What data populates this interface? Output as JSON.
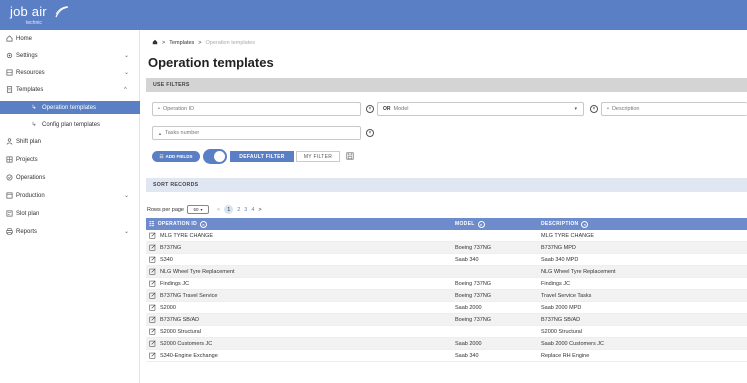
{
  "app": {
    "logo": "job air",
    "logo_sub": "technic"
  },
  "sidebar": {
    "items": [
      {
        "label": "Home",
        "icon": "home-icon"
      },
      {
        "label": "Settings",
        "icon": "gear-icon"
      },
      {
        "label": "Resources",
        "icon": "resources-icon"
      },
      {
        "label": "Templates",
        "icon": "document-icon"
      },
      {
        "label": "Operation templates",
        "icon": "sub-arrow-icon"
      },
      {
        "label": "Config plan templates",
        "icon": "sub-arrow-icon"
      },
      {
        "label": "Shift plan",
        "icon": "person-icon"
      },
      {
        "label": "Projects",
        "icon": "projects-icon"
      },
      {
        "label": "Operations",
        "icon": "operations-icon"
      },
      {
        "label": "Production",
        "icon": "production-icon"
      },
      {
        "label": "Slot plan",
        "icon": "slot-icon"
      },
      {
        "label": "Reports",
        "icon": "print-icon"
      }
    ]
  },
  "breadcrumb": {
    "sep": ">",
    "templates": "Templates",
    "current": "Operation templates"
  },
  "page": {
    "title": "Operation templates"
  },
  "filters": {
    "header": "USE FILTERS",
    "operation_id_placeholder": "Operation ID",
    "or_label": "OR",
    "model_placeholder": "Model",
    "description_placeholder": "Description",
    "tasks_placeholder": "Tasks number",
    "add_fields": "ADD FIELDS",
    "default_filter": "DEFAULT FILTER",
    "my_filter": "MY FILTER"
  },
  "sort": {
    "header": "SORT RECORDS"
  },
  "pager": {
    "rows_per_page_label": "Rows per page",
    "rows_per_page_value": "50",
    "prev": "<",
    "pages": [
      "1",
      "2",
      "3",
      "4"
    ],
    "next": ">"
  },
  "table": {
    "columns": [
      "OPERATION ID",
      "MODEL",
      "DESCRIPTION"
    ],
    "rows": [
      [
        "MLG TYRE CHANGE",
        "",
        "MLG TYRE CHANGE"
      ],
      [
        "B737NG",
        "Boeing 737NG",
        "B737NG MPD"
      ],
      [
        "S340",
        "Saab 340",
        "Saab 340 MPD"
      ],
      [
        "NLG Wheel Tyre Replacement",
        "",
        "NLG Wheel Tyre Replacement"
      ],
      [
        "Findings JC",
        "Boeing 737NG",
        "Findings JC"
      ],
      [
        "B737NG Travel Service",
        "Boeing 737NG",
        "Travel Service Tasks"
      ],
      [
        "S2000",
        "Saab 2000",
        "Saab 2000 MPD"
      ],
      [
        "B737NG SB/AD",
        "Boeing 737NG",
        "B737NG SB/AD"
      ],
      [
        "S2000 Structural",
        "",
        "S2000 Structural"
      ],
      [
        "S2000 Customers JC",
        "Saab 2000",
        "Saab 2000 Customers JC"
      ],
      [
        "S340-Engine Exchange",
        "Saab 340",
        "Replace RH Engine"
      ]
    ]
  },
  "colors": {
    "brand": "#5b7fc4",
    "table_header": "#6e8ccb",
    "filter_header": "#d4d4d4"
  }
}
